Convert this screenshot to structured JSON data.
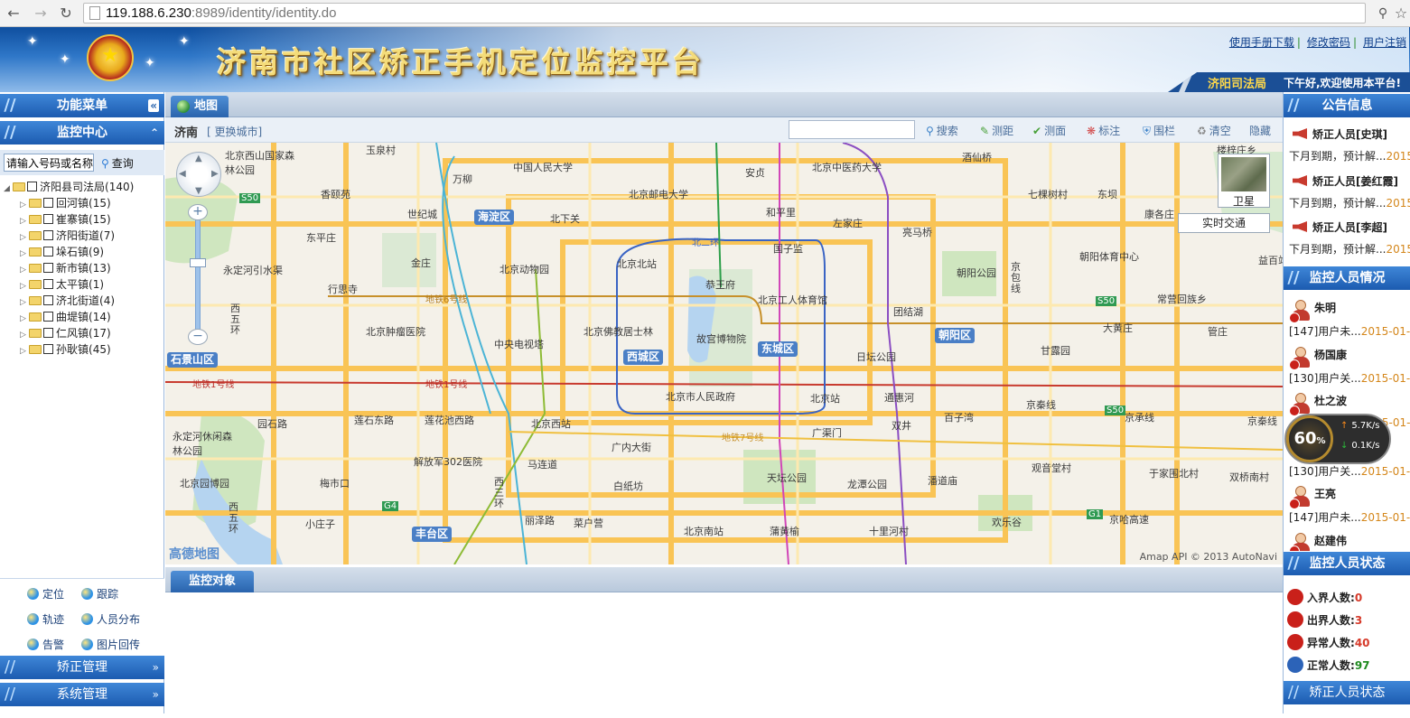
{
  "browser": {
    "url_host": "119.188.6.230",
    "url_rest": ":8989/identity/identity.do"
  },
  "header": {
    "title": "济南市社区矫正手机定位监控平台",
    "links": [
      "使用手册下载",
      "修改密码",
      "用户注销"
    ],
    "org": "济阳司法局",
    "welcome": "下午好,欢迎使用本平台!"
  },
  "left": {
    "menu_title": "功能菜单",
    "monitor_title": "监控中心",
    "search_placeholder": "请输入号码或名称",
    "search_button": "查询",
    "tree_root": {
      "label": "济阳县司法局",
      "count": "(140)"
    },
    "tree_items": [
      {
        "label": "回河镇",
        "count": "(15)"
      },
      {
        "label": "崔寨镇",
        "count": "(15)"
      },
      {
        "label": "济阳街道",
        "count": "(7)"
      },
      {
        "label": "垛石镇",
        "count": "(9)"
      },
      {
        "label": "新市镇",
        "count": "(13)"
      },
      {
        "label": "太平镇",
        "count": "(1)"
      },
      {
        "label": "济北街道",
        "count": "(4)"
      },
      {
        "label": "曲堤镇",
        "count": "(14)"
      },
      {
        "label": "仁风镇",
        "count": "(17)"
      },
      {
        "label": "孙耿镇",
        "count": "(45)"
      }
    ],
    "actions": [
      "定位",
      "跟踪",
      "轨迹",
      "人员分布",
      "告警",
      "图片回传"
    ],
    "bottom_menus": [
      "矫正管理",
      "系统管理"
    ]
  },
  "center": {
    "map_tab": "地图",
    "city": "济南",
    "change_city": "[ 更换城市]",
    "tools": [
      "搜索",
      "测距",
      "测面",
      "标注",
      "围栏",
      "清空",
      "隐藏"
    ],
    "satellite_label": "卫星",
    "traffic_label": "实时交通",
    "map_logo": "高德地图",
    "copyright": "Amap API © 2013 AutoNavi",
    "monitor_tab": "监控对象"
  },
  "map_labels": {
    "districts": [
      "海淀区",
      "西城区",
      "东城区",
      "朝阳区",
      "石景山区",
      "丰台区"
    ],
    "places": [
      "玉泉村",
      "北京西山国家森林公园",
      "万柳",
      "中国人民大学",
      "安贞",
      "北京中医药大学",
      "酒仙桥",
      "楼梓庄乡",
      "香颐苑",
      "北京邮电大学",
      "和平里",
      "七棵树村",
      "东坝",
      "世纪城",
      "北下关",
      "左家庄",
      "亮马桥",
      "康各庄",
      "东平庄",
      "金庄",
      "北京动物园",
      "北京北站",
      "国子监",
      "朝阳公园",
      "朝阳体育中心",
      "益百站",
      "永定河引水渠",
      "行思寺",
      "恭王府",
      "北京工人体育馆",
      "团结湖",
      "常营回族乡",
      "北京肿瘤医院",
      "北京佛教居士林",
      "故宫博物院",
      "中央电视塔",
      "日坛公园",
      "甘露园",
      "大黄庄",
      "管庄",
      "北京市人民政府",
      "北京站",
      "通惠河",
      "京秦线",
      "百子湾",
      "京承线",
      "京秦线",
      "永定河休闲森林公园",
      "园石路",
      "莲石东路",
      "莲花池西路",
      "北京西站",
      "广内大街",
      "广渠门",
      "双井",
      "解放军302医院",
      "马连道",
      "观音堂村",
      "于家围北村",
      "双桥南村",
      "北京园博园",
      "梅市口",
      "白纸坊",
      "天坛公园",
      "龙潭公园",
      "潘道庙",
      "小庄子",
      "丽泽路",
      "菜户营",
      "北京南站",
      "蒲黄榆",
      "十里河村",
      "欢乐谷",
      "京哈高速"
    ],
    "metros": [
      "地铁6号线",
      "地铁1号线",
      "地铁1号线",
      "北二环",
      "地铁7号线"
    ],
    "roads": [
      "S50",
      "S50",
      "S50",
      "G4",
      "G1",
      "京包线",
      "西五环",
      "西四环",
      "西三环",
      "西五环"
    ]
  },
  "right": {
    "notice_title": "公告信息",
    "notices": [
      {
        "title": "矫正人员[史琪]",
        "desc": "下月到期，预计解...",
        "date": "2015"
      },
      {
        "title": "矫正人员[姜红霞]",
        "desc": "下月到期，预计解...",
        "date": "2015"
      },
      {
        "title": "矫正人员[李超]",
        "desc": "下月到期，预计解...",
        "date": "2015"
      }
    ],
    "monitor_title": "监控人员情况",
    "persons": [
      {
        "name": "朱明",
        "status": "[147]用户未...",
        "date": "2015-01-2"
      },
      {
        "name": "杨国康",
        "status": "[130]用户关...",
        "date": "2015-01-2"
      },
      {
        "name": "杜之波",
        "status": "",
        "date": "2015-01-2"
      },
      {
        "name": "",
        "status": "[130]用户关...",
        "date": "2015-01-2"
      },
      {
        "name": "王亮",
        "status": "[147]用户未...",
        "date": "2015-01-2"
      },
      {
        "name": "赵建伟",
        "status": "",
        "date": ""
      }
    ],
    "state_title": "监控人员状态",
    "stats": [
      {
        "label": "入界人数:",
        "value": "0",
        "color": "#d63a2a"
      },
      {
        "label": "出界人数:",
        "value": "3",
        "color": "#d63a2a"
      },
      {
        "label": "异常人数:",
        "value": "40",
        "color": "#d63a2a"
      },
      {
        "label": "正常人数:",
        "value": "97",
        "color": "#1f8a1f"
      }
    ],
    "bottom_title": "矫正人员状态"
  },
  "speed_widget": {
    "percent": "60",
    "percent_sign": "%",
    "up": "5.7",
    "down": "0.1",
    "unit": "K/s"
  },
  "colors": {
    "header_blue": "#1c5bb0",
    "title_gold": "#f4dc7a",
    "accent_orange": "#d4861a"
  }
}
